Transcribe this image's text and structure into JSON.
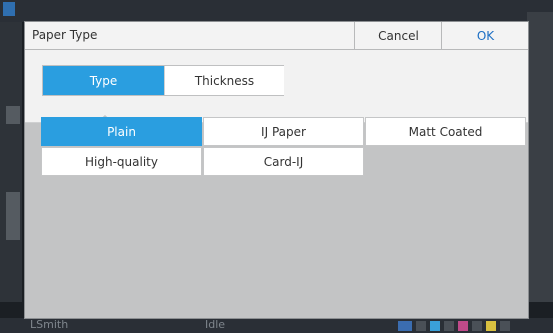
{
  "background": {
    "status_user": "LSmith",
    "status_state": "Idle"
  },
  "dialog": {
    "title": "Paper Type",
    "cancel_label": "Cancel",
    "ok_label": "OK",
    "tabs": [
      {
        "label": "Type",
        "active": true
      },
      {
        "label": "Thickness",
        "active": false
      }
    ],
    "options": [
      {
        "label": "Plain",
        "selected": true
      },
      {
        "label": "IJ Paper",
        "selected": false
      },
      {
        "label": "Matt Coated",
        "selected": false
      },
      {
        "label": "High-quality",
        "selected": false
      },
      {
        "label": "Card-IJ",
        "selected": false
      }
    ]
  },
  "colors": {
    "accent": "#2a9ee0",
    "ok_text": "#1d6fc4",
    "panel": "#c3c4c5"
  }
}
